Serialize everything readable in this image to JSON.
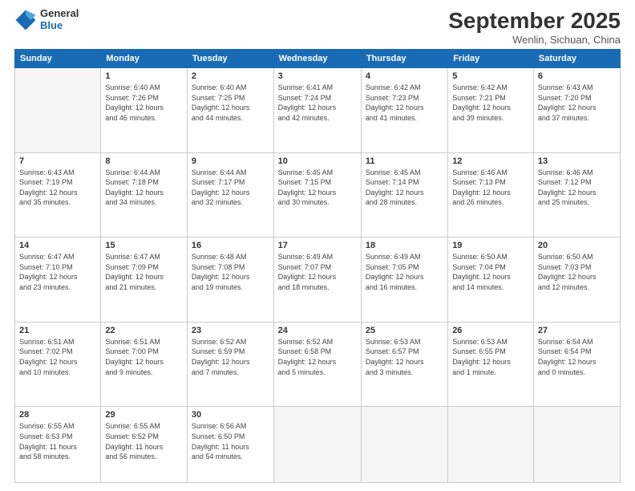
{
  "header": {
    "logo": {
      "line1": "General",
      "line2": "Blue"
    },
    "title": "September 2025",
    "location": "Wenlin, Sichuan, China"
  },
  "days_of_week": [
    "Sunday",
    "Monday",
    "Tuesday",
    "Wednesday",
    "Thursday",
    "Friday",
    "Saturday"
  ],
  "weeks": [
    [
      {
        "day": "",
        "info": ""
      },
      {
        "day": "1",
        "info": "Sunrise: 6:40 AM\nSunset: 7:26 PM\nDaylight: 12 hours\nand 46 minutes."
      },
      {
        "day": "2",
        "info": "Sunrise: 6:40 AM\nSunset: 7:25 PM\nDaylight: 12 hours\nand 44 minutes."
      },
      {
        "day": "3",
        "info": "Sunrise: 6:41 AM\nSunset: 7:24 PM\nDaylight: 12 hours\nand 42 minutes."
      },
      {
        "day": "4",
        "info": "Sunrise: 6:42 AM\nSunset: 7:23 PM\nDaylight: 12 hours\nand 41 minutes."
      },
      {
        "day": "5",
        "info": "Sunrise: 6:42 AM\nSunset: 7:21 PM\nDaylight: 12 hours\nand 39 minutes."
      },
      {
        "day": "6",
        "info": "Sunrise: 6:43 AM\nSunset: 7:20 PM\nDaylight: 12 hours\nand 37 minutes."
      }
    ],
    [
      {
        "day": "7",
        "info": "Sunrise: 6:43 AM\nSunset: 7:19 PM\nDaylight: 12 hours\nand 35 minutes."
      },
      {
        "day": "8",
        "info": "Sunrise: 6:44 AM\nSunset: 7:18 PM\nDaylight: 12 hours\nand 34 minutes."
      },
      {
        "day": "9",
        "info": "Sunrise: 6:44 AM\nSunset: 7:17 PM\nDaylight: 12 hours\nand 32 minutes."
      },
      {
        "day": "10",
        "info": "Sunrise: 6:45 AM\nSunset: 7:15 PM\nDaylight: 12 hours\nand 30 minutes."
      },
      {
        "day": "11",
        "info": "Sunrise: 6:45 AM\nSunset: 7:14 PM\nDaylight: 12 hours\nand 28 minutes."
      },
      {
        "day": "12",
        "info": "Sunrise: 6:46 AM\nSunset: 7:13 PM\nDaylight: 12 hours\nand 26 minutes."
      },
      {
        "day": "13",
        "info": "Sunrise: 6:46 AM\nSunset: 7:12 PM\nDaylight: 12 hours\nand 25 minutes."
      }
    ],
    [
      {
        "day": "14",
        "info": "Sunrise: 6:47 AM\nSunset: 7:10 PM\nDaylight: 12 hours\nand 23 minutes."
      },
      {
        "day": "15",
        "info": "Sunrise: 6:47 AM\nSunset: 7:09 PM\nDaylight: 12 hours\nand 21 minutes."
      },
      {
        "day": "16",
        "info": "Sunrise: 6:48 AM\nSunset: 7:08 PM\nDaylight: 12 hours\nand 19 minutes."
      },
      {
        "day": "17",
        "info": "Sunrise: 6:49 AM\nSunset: 7:07 PM\nDaylight: 12 hours\nand 18 minutes."
      },
      {
        "day": "18",
        "info": "Sunrise: 6:49 AM\nSunset: 7:05 PM\nDaylight: 12 hours\nand 16 minutes."
      },
      {
        "day": "19",
        "info": "Sunrise: 6:50 AM\nSunset: 7:04 PM\nDaylight: 12 hours\nand 14 minutes."
      },
      {
        "day": "20",
        "info": "Sunrise: 6:50 AM\nSunset: 7:03 PM\nDaylight: 12 hours\nand 12 minutes."
      }
    ],
    [
      {
        "day": "21",
        "info": "Sunrise: 6:51 AM\nSunset: 7:02 PM\nDaylight: 12 hours\nand 10 minutes."
      },
      {
        "day": "22",
        "info": "Sunrise: 6:51 AM\nSunset: 7:00 PM\nDaylight: 12 hours\nand 9 minutes."
      },
      {
        "day": "23",
        "info": "Sunrise: 6:52 AM\nSunset: 6:59 PM\nDaylight: 12 hours\nand 7 minutes."
      },
      {
        "day": "24",
        "info": "Sunrise: 6:52 AM\nSunset: 6:58 PM\nDaylight: 12 hours\nand 5 minutes."
      },
      {
        "day": "25",
        "info": "Sunrise: 6:53 AM\nSunset: 6:57 PM\nDaylight: 12 hours\nand 3 minutes."
      },
      {
        "day": "26",
        "info": "Sunrise: 6:53 AM\nSunset: 6:55 PM\nDaylight: 12 hours\nand 1 minute."
      },
      {
        "day": "27",
        "info": "Sunrise: 6:54 AM\nSunset: 6:54 PM\nDaylight: 12 hours\nand 0 minutes."
      }
    ],
    [
      {
        "day": "28",
        "info": "Sunrise: 6:55 AM\nSunset: 6:53 PM\nDaylight: 11 hours\nand 58 minutes."
      },
      {
        "day": "29",
        "info": "Sunrise: 6:55 AM\nSunset: 6:52 PM\nDaylight: 11 hours\nand 56 minutes."
      },
      {
        "day": "30",
        "info": "Sunrise: 6:56 AM\nSunset: 6:50 PM\nDaylight: 11 hours\nand 54 minutes."
      },
      {
        "day": "",
        "info": ""
      },
      {
        "day": "",
        "info": ""
      },
      {
        "day": "",
        "info": ""
      },
      {
        "day": "",
        "info": ""
      }
    ]
  ]
}
